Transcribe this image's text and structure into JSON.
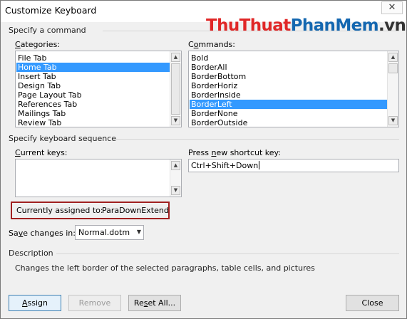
{
  "window": {
    "title": "Customize Keyboard",
    "close_glyph": "✕"
  },
  "watermark": {
    "part1": "Thu",
    "part2": "Thuat",
    "part3": "Phan",
    "part4": "Mem",
    "part5": ".vn"
  },
  "specify_command": {
    "section_label": "Specify a command",
    "categories_label_first": "C",
    "categories_label_rest": "ategories:",
    "categories": [
      {
        "label": "File Tab",
        "selected": false
      },
      {
        "label": "Home Tab",
        "selected": true
      },
      {
        "label": "Insert Tab",
        "selected": false
      },
      {
        "label": "Design Tab",
        "selected": false
      },
      {
        "label": "Page Layout Tab",
        "selected": false
      },
      {
        "label": "References Tab",
        "selected": false
      },
      {
        "label": "Mailings Tab",
        "selected": false
      },
      {
        "label": "Review Tab",
        "selected": false
      }
    ],
    "commands_label_first": "C",
    "commands_label_underlined": "o",
    "commands_label_rest": "mmands:",
    "commands": [
      {
        "label": "Bold",
        "selected": false
      },
      {
        "label": "BorderAll",
        "selected": false
      },
      {
        "label": "BorderBottom",
        "selected": false
      },
      {
        "label": "BorderHoriz",
        "selected": false
      },
      {
        "label": "BorderInside",
        "selected": false
      },
      {
        "label": "BorderLeft",
        "selected": true
      },
      {
        "label": "BorderNone",
        "selected": false
      },
      {
        "label": "BorderOutside",
        "selected": false
      }
    ]
  },
  "keyboard_sequence": {
    "section_label": "Specify keyboard sequence",
    "current_keys_label_underlined": "C",
    "current_keys_label_rest": "urrent keys:",
    "press_label_first": "Press ",
    "press_label_underlined": "n",
    "press_label_rest": "ew shortcut key:",
    "shortcut_value": "Ctrl+Shift+Down"
  },
  "assignment": {
    "label": "Currently assigned to:",
    "value": "ParaDownExtend"
  },
  "save_changes": {
    "label_first": "Sa",
    "label_underlined": "v",
    "label_rest": "e changes in:",
    "value": "Normal.dotm"
  },
  "description": {
    "section_label": "Description",
    "text": "Changes the left border of the selected paragraphs, table cells, and pictures"
  },
  "buttons": {
    "assign_underlined": "A",
    "assign_rest": "ssign",
    "remove": "Remove",
    "reset_first": "Re",
    "reset_underlined": "s",
    "reset_rest": "et All...",
    "close": "Close"
  }
}
